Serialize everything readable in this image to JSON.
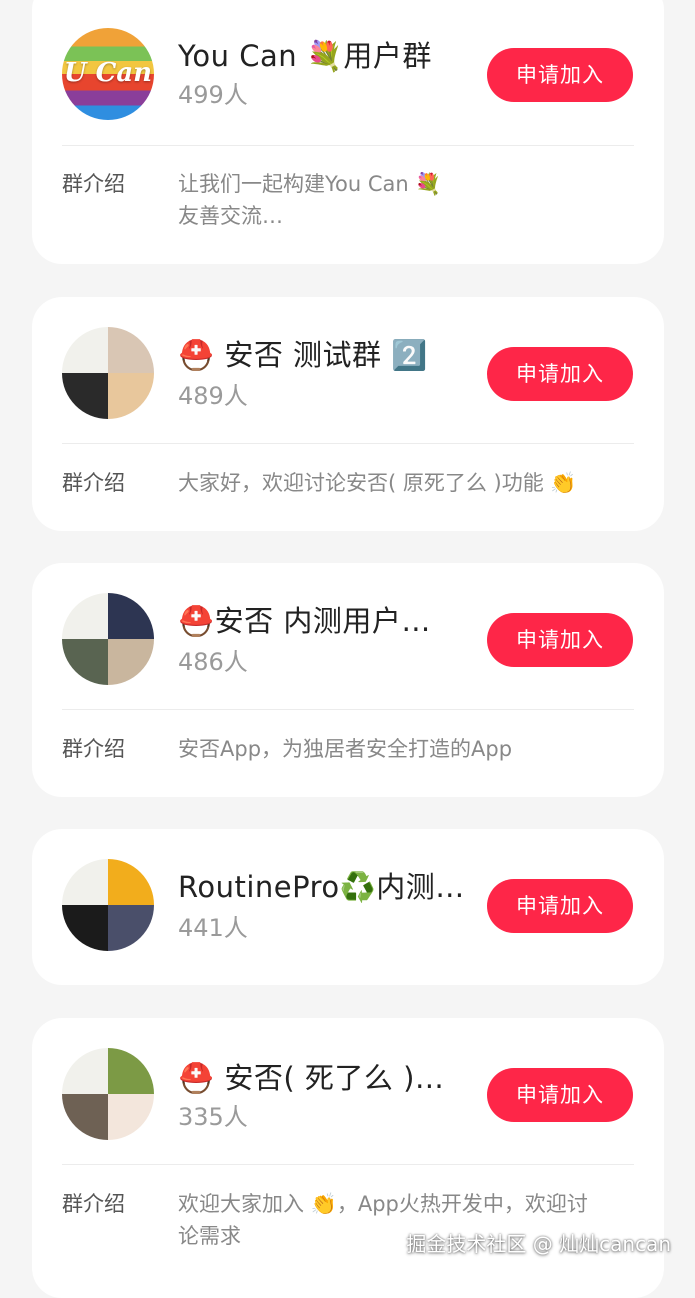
{
  "groups": [
    {
      "title": "You Can 💐用户群",
      "count": "499人",
      "join_label": "申请加入",
      "intro_label": "群介绍",
      "intro_text": "让我们一起构建You Can 💐\n友善交流…",
      "avatar": "U Can"
    },
    {
      "title": "⛑️ 安否 测试群 2️⃣",
      "count": "489人",
      "join_label": "申请加入",
      "intro_label": "群介绍",
      "intro_text": "大家好，欢迎讨论安否( 原死了么 )功能 👏"
    },
    {
      "title": "⛑️安否 内测用户…",
      "count": "486人",
      "join_label": "申请加入",
      "intro_label": "群介绍",
      "intro_text": "安否App，为独居者安全打造的App"
    },
    {
      "title": "RoutinePro♻️内测…",
      "count": "441人",
      "join_label": "申请加入"
    },
    {
      "title": "⛑️ 安否( 死了么 )…",
      "count": "335人",
      "join_label": "申请加入",
      "intro_label": "群介绍",
      "intro_text": "欢迎大家加入 👏，App火热开发中，欢迎讨\n论需求"
    }
  ],
  "watermark": "掘金技术社区 @ 灿灿cancan",
  "colors": {
    "page_background": "#f5f5f5",
    "card_background": "#ffffff",
    "join_button": "#fe2648"
  }
}
